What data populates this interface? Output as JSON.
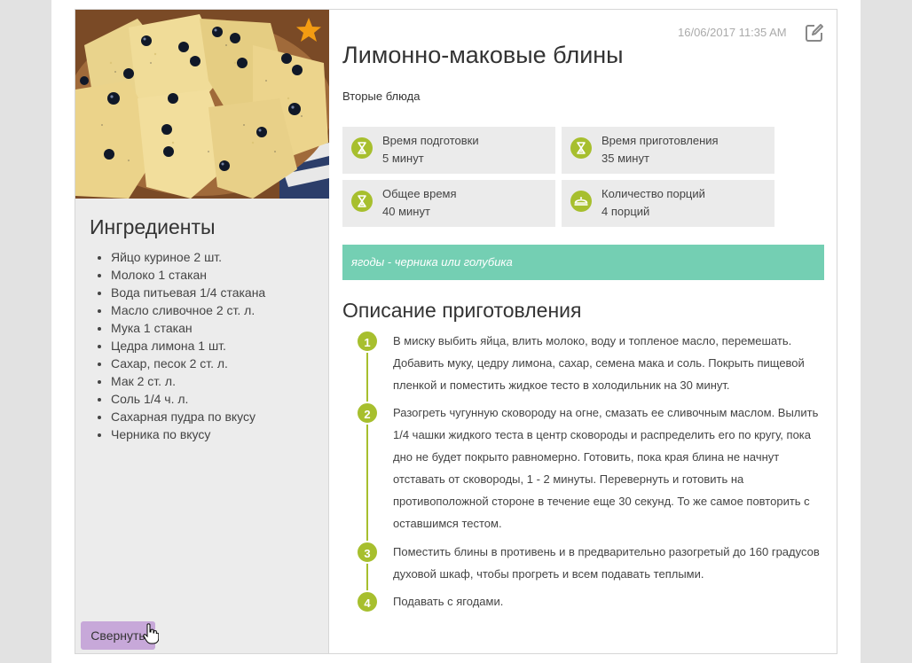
{
  "recipe": {
    "date": "16/06/2017 11:35 AM",
    "title": "Лимонно-маковые блины",
    "category": "Вторые блюда",
    "note": "ягоды - черника или голубика"
  },
  "info": [
    {
      "label": "Время подготовки",
      "value": "5 минут",
      "icon": "hourglass-icon"
    },
    {
      "label": "Время приготовления",
      "value": "35 минут",
      "icon": "hourglass-icon"
    },
    {
      "label": "Общее время",
      "value": "40 минут",
      "icon": "hourglass-icon"
    },
    {
      "label": "Количество порций",
      "value": "4 порций",
      "icon": "serving-dish-icon"
    }
  ],
  "ingredients": {
    "title": "Ингредиенты",
    "items": [
      "Яйцо куриное 2 шт.",
      "Молоко 1 стакан",
      "Вода питьевая 1/4 стакана",
      "Масло сливочное 2 ст. л.",
      "Мука 1 стакан",
      "Цедра лимона 1 шт.",
      "Сахар, песок 2 ст. л.",
      "Мак 2 ст. л.",
      "Соль 1/4 ч. л.",
      "Сахарная пудра по вкусу",
      "Черника по вкусу"
    ]
  },
  "description": {
    "title": "Описание приготовления",
    "steps": [
      {
        "num": "1",
        "text": "В миску выбить яйца, влить молоко, воду и топленое масло, перемешать. Добавить муку, цедру лимона, сахар, семена мака и соль. Покрыть пищевой пленкой и поместить жидкое тесто в холодильник на 30 минут."
      },
      {
        "num": "2",
        "text": "Разогреть чугунную сковороду на огне, смазать ее сливочным маслом. Вылить 1/4 чашки жидкого теста в центр сковороды и распределить его по кругу, пока дно не будет покрыто равномерно. Готовить, пока края блина не начнут отставать от сковороды, 1 - 2 минуты. Перевернуть и готовить на противоположной стороне в течение еще 30 секунд. То же самое повторить с оставшимся тестом."
      },
      {
        "num": "3",
        "text": "Поместить блины в противень и в предварительно разогретый до 160 градусов духовой шкаф, чтобы прогреть и всем подавать теплыми."
      },
      {
        "num": "4",
        "text": "Подавать с ягодами."
      }
    ]
  },
  "buttons": {
    "collapse": "Свернуть"
  },
  "colors": {
    "accent_green": "#a7bf2e",
    "note_bg": "#74cfb3",
    "collapse_btn": "#c7a8d9",
    "favorite_star": "#f39c12"
  }
}
